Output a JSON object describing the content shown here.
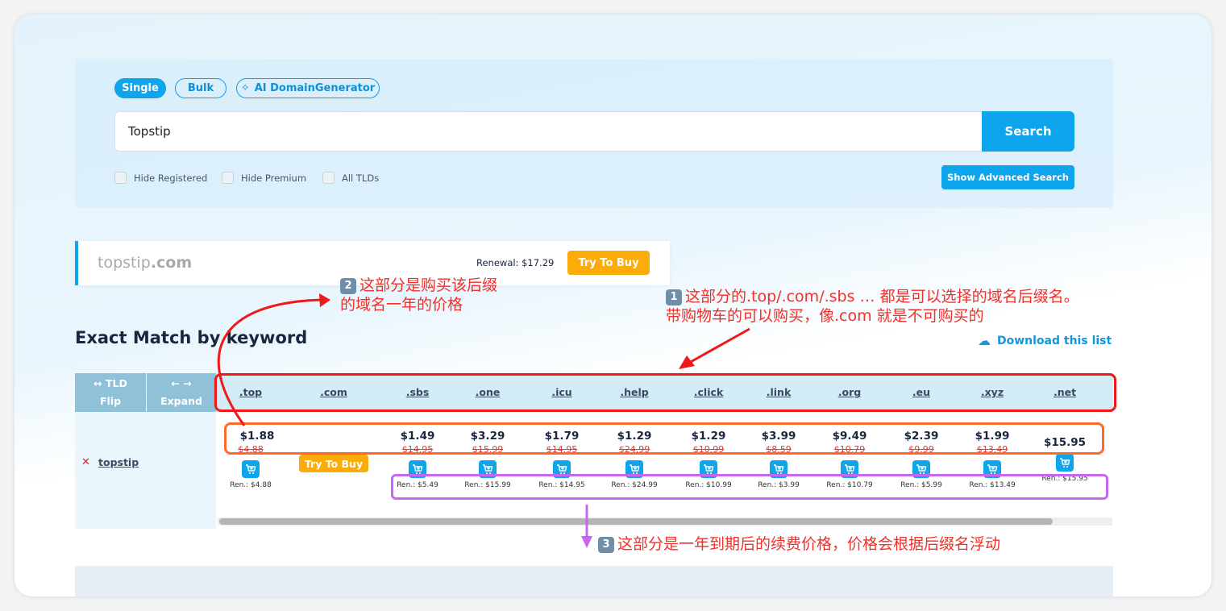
{
  "search": {
    "modes": [
      {
        "label": "Single",
        "active": true
      },
      {
        "label": "Bulk",
        "active": false
      },
      {
        "label": "AI DomainGenerator",
        "active": false,
        "icon": "sparkle-icon"
      }
    ],
    "query": "Topstip",
    "button": "Search",
    "filters": [
      {
        "label": "Hide Registered",
        "checked": false
      },
      {
        "label": "Hide Premium",
        "checked": false
      },
      {
        "label": "All TLDs",
        "checked": false
      }
    ],
    "advanced": "Show Advanced Search"
  },
  "featured": {
    "name": "topstip",
    "tld": ".com",
    "renewal": "Renewal: $17.29",
    "button": "Try To Buy"
  },
  "results": {
    "title": "Exact Match by keyword",
    "download": "Download this list",
    "flip_top": "↔ TLD",
    "flip_bottom": "Flip",
    "expand_top": "← →",
    "expand_bottom": "Expand",
    "row_domain": "topstip",
    "row_status": "taken",
    "try_buy": "Try To Buy",
    "tlds": [
      {
        "tld": ".top",
        "price": "$1.88",
        "old": "$4.88",
        "ren": "Ren.: $4.88",
        "cart": true
      },
      {
        "tld": ".com",
        "price": "",
        "old": "",
        "ren": "",
        "cart": false
      },
      {
        "tld": ".sbs",
        "price": "$1.49",
        "old": "$14.95",
        "ren": "Ren.: $5.49",
        "cart": true
      },
      {
        "tld": ".one",
        "price": "$3.29",
        "old": "$15.99",
        "ren": "Ren.: $15.99",
        "cart": true
      },
      {
        "tld": ".icu",
        "price": "$1.79",
        "old": "$14.95",
        "ren": "Ren.: $14.95",
        "cart": true
      },
      {
        "tld": ".help",
        "price": "$1.29",
        "old": "$24.99",
        "ren": "Ren.: $24.99",
        "cart": true
      },
      {
        "tld": ".click",
        "price": "$1.29",
        "old": "$10.99",
        "ren": "Ren.: $10.99",
        "cart": true
      },
      {
        "tld": ".link",
        "price": "$3.99",
        "old": "$8.59",
        "ren": "Ren.: $3.99",
        "cart": true
      },
      {
        "tld": ".org",
        "price": "$9.49",
        "old": "$10.79",
        "ren": "Ren.: $10.79",
        "cart": true
      },
      {
        "tld": ".eu",
        "price": "$2.39",
        "old": "$9.99",
        "ren": "Ren.: $5.99",
        "cart": true
      },
      {
        "tld": ".xyz",
        "price": "$1.99",
        "old": "$13.49",
        "ren": "Ren.: $13.49",
        "cart": true
      },
      {
        "tld": ".net",
        "price": "$15.95",
        "old": "",
        "ren": "Ren.: $15.95",
        "cart": true
      }
    ]
  },
  "annotations": {
    "note1_badge": "1",
    "note1_line1": "这部分的.top/.com/.sbs … 都是可以选择的域名后缀名。",
    "note1_line2": "带购物车的可以购买，像.com 就是不可购买的",
    "note2_badge": "2",
    "note2_line1": "这部分是购买该后缀",
    "note2_line2": "的域名一年的价格",
    "note3_badge": "3",
    "note3_line1": "这部分是一年到期后的续费价格，价格会根据后缀名浮动",
    "colors": {
      "tld_box": "#f01818",
      "price_box": "#ff6a2a",
      "renewal_box": "#c766f0",
      "arrow": "#f01818"
    }
  },
  "colors": {
    "accent": "#0ea5ec",
    "buy": "#fbab0a",
    "strike": "#e23b3b"
  }
}
